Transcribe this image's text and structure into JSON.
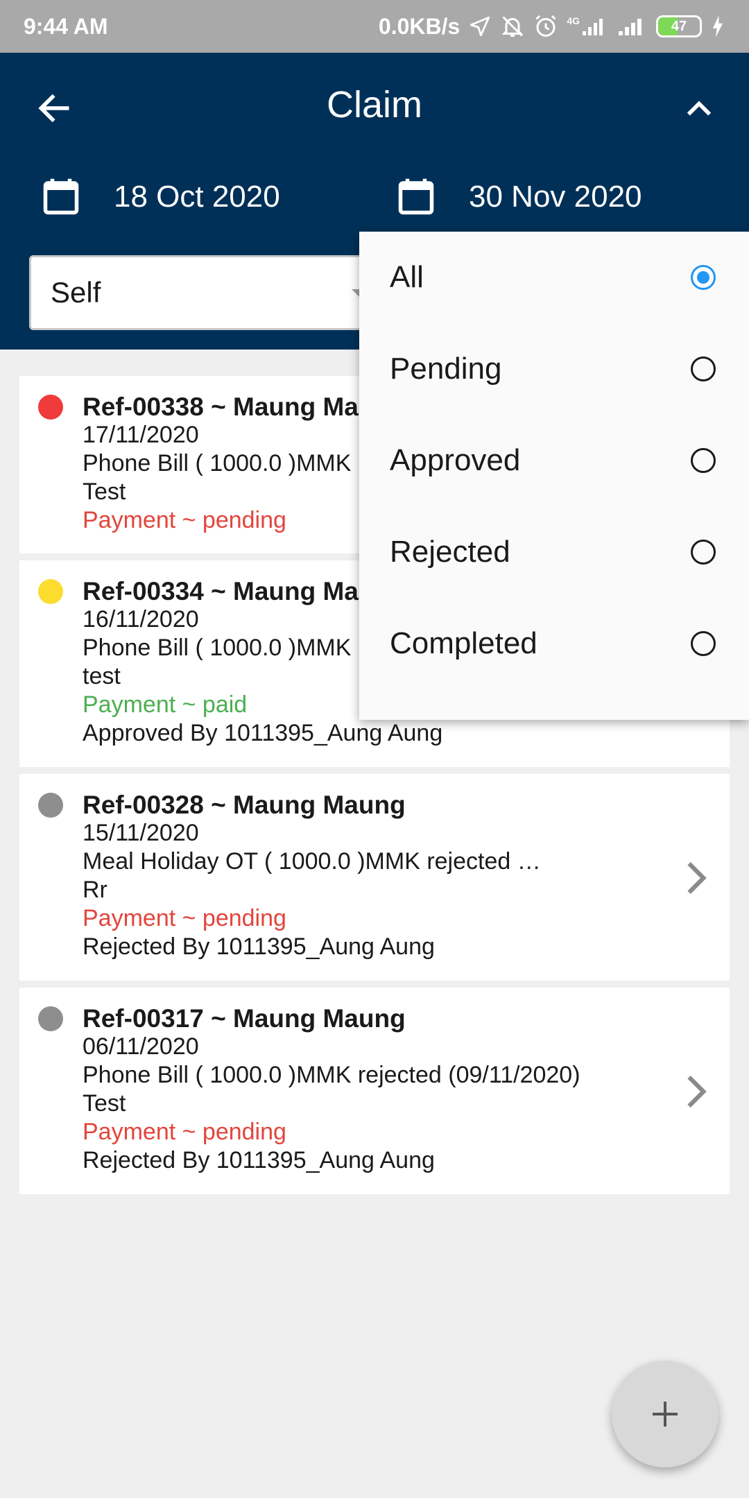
{
  "status_bar": {
    "time": "9:44 AM",
    "net_speed": "0.0KB/s",
    "network": "4G",
    "battery": "47",
    "battery_level": 0.47,
    "icons": [
      "location-arrow-icon",
      "mute-icon",
      "alarm-icon",
      "signal-4g-icon",
      "signal-icon",
      "battery-icon",
      "charging-icon"
    ]
  },
  "header": {
    "title": "Claim",
    "from_date": "18 Oct 2020",
    "to_date": "30 Nov 2020",
    "scope_value": "Self"
  },
  "claims": [
    {
      "ref": "Ref-00338 ~ Maung Ma",
      "date": "17/11/2020",
      "detail": "Phone Bill ( 1000.0 )MMK",
      "note": "Test",
      "payment": "Payment ~ pending",
      "payment_status": "pending",
      "dot_color": "#ef3b3b",
      "approver": ""
    },
    {
      "ref": "Ref-00334 ~ Maung Ma",
      "date": "16/11/2020",
      "detail": "Phone Bill ( 1000.0 )MMK",
      "note": "test",
      "payment": "Payment ~ paid",
      "payment_status": "paid",
      "dot_color": "#fbdc2f",
      "approver": "Approved By 1011395_Aung Aung"
    },
    {
      "ref": "Ref-00328 ~ Maung Maung",
      "date": "15/11/2020",
      "detail": "Meal Holiday OT ( 1000.0 )MMK rejected …",
      "note": "Rr",
      "payment": "Payment ~ pending",
      "payment_status": "pending",
      "dot_color": "#8e8e8e",
      "approver": "Rejected By 1011395_Aung Aung"
    },
    {
      "ref": "Ref-00317 ~ Maung Maung",
      "date": "06/11/2020",
      "detail": "Phone Bill ( 1000.0 )MMK rejected (09/11/2020)",
      "note": "Test",
      "payment": "Payment ~ pending",
      "payment_status": "pending",
      "dot_color": "#8e8e8e",
      "approver": "Rejected By 1011395_Aung Aung"
    }
  ],
  "status_filter": {
    "selected": "All",
    "options": [
      "All",
      "Pending",
      "Approved",
      "Rejected",
      "Completed"
    ]
  },
  "colors": {
    "header_bg": "#003057",
    "pending": "#e2453c",
    "paid": "#4caf50",
    "radio_selected": "#2196f3"
  }
}
